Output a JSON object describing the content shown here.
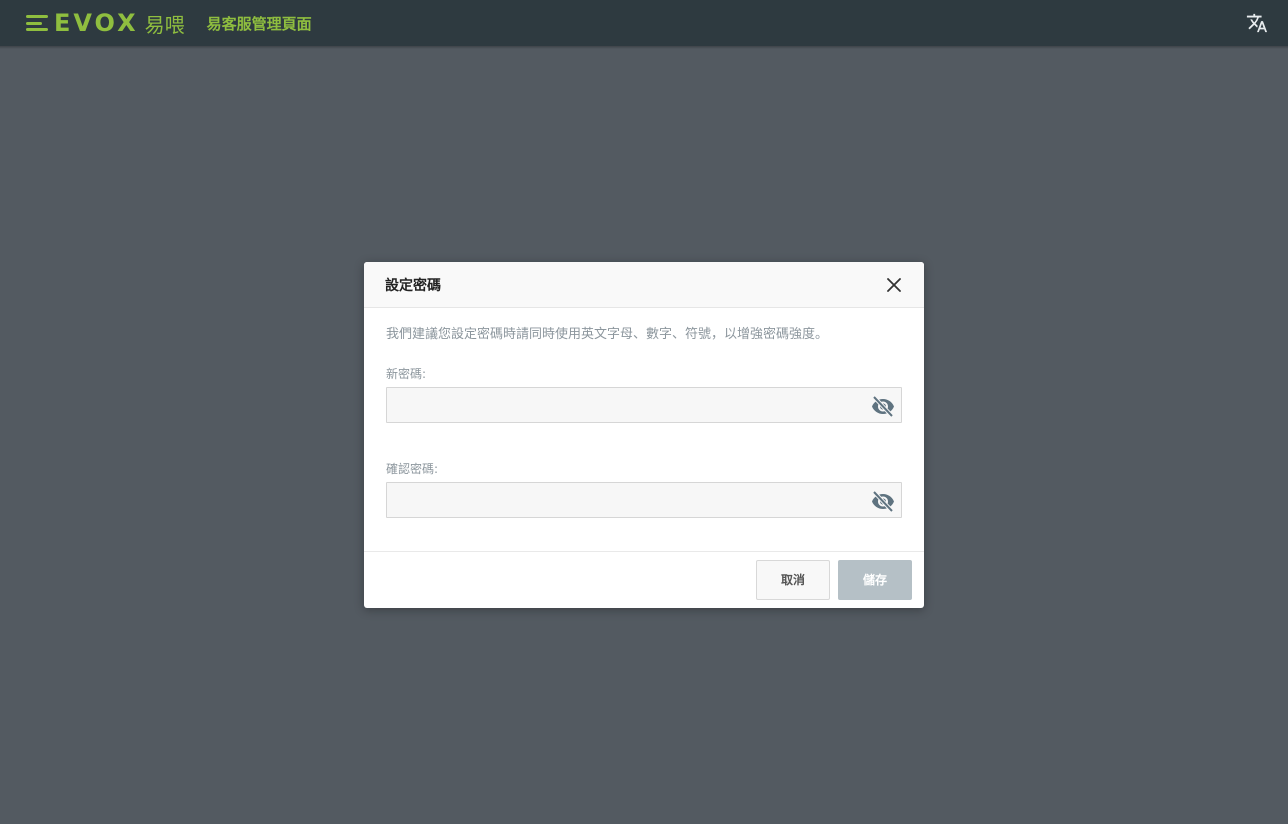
{
  "header": {
    "logo_text": "EVOX",
    "logo_cn": "易喂",
    "app_title": "易客服管理頁面",
    "translate_icon": "translate-icon"
  },
  "dialog": {
    "title": "設定密碼",
    "hint": "我們建議您設定密碼時請同時使用英文字母、數字、符號，以增強密碼強度。",
    "new_password_label": "新密碼:",
    "new_password_value": "",
    "confirm_password_label": "確認密碼:",
    "confirm_password_value": "",
    "cancel_label": "取消",
    "save_label": "儲存"
  },
  "colors": {
    "topbar": "#2e3a40",
    "brand_green": "#8fbe3f",
    "overlay": "#535a61",
    "save_disabled": "#b5c0c6"
  }
}
